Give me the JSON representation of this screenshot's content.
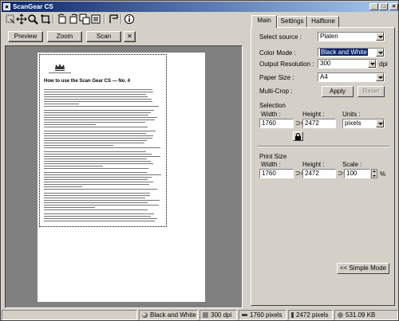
{
  "window": {
    "title": "ScanGear CS",
    "controls": {
      "minimize": "_",
      "maximize": "□",
      "close": "×"
    }
  },
  "toolbar_icons": [
    "marquee-select-icon",
    "move-icon",
    "zoom-icon",
    "crop-icon",
    "rotate-left-icon",
    "rotate-right-icon",
    "copy-icon",
    "auto-crop-icon",
    "mirror-icon",
    "info-icon"
  ],
  "buttons": {
    "preview": "Preview",
    "zoom": "Zoom",
    "scan": "Scan",
    "clear": "✕"
  },
  "preview": {
    "document_heading": "How to use the Scan Gear CS — No. 4"
  },
  "tabs": [
    {
      "label": "Main",
      "active": true
    },
    {
      "label": "Settings",
      "active": false
    },
    {
      "label": "Halftone",
      "active": false
    }
  ],
  "main": {
    "select_source_label": "Select source :",
    "select_source_value": "Platen",
    "color_mode_label": "Color Mode :",
    "color_mode_value": "Black and White",
    "output_resolution_label": "Output Resolution :",
    "output_resolution_value": "300",
    "dpi_unit": "dpi",
    "paper_size_label": "Paper Size :",
    "paper_size_value": "A4",
    "multi_crop_label": "Multi-Crop :",
    "apply_label": "Apply",
    "reset_label": "Reset",
    "selection_label": "Selection",
    "width_label": "Width :",
    "height_label": "Height :",
    "units_label": "Units :",
    "selection_width": "1760",
    "selection_height": "2472",
    "units_value": "pixels",
    "print_size_label": "Print Size",
    "print_width_label": "Width :",
    "print_height_label": "Height :",
    "scale_label": "Scale :",
    "print_width": "1760",
    "print_height": "2472",
    "scale_value": "100",
    "percent": "%",
    "simple_mode_label": "<< Simple Mode"
  },
  "status": {
    "color_mode": "Black and White",
    "resolution": "300 dpi",
    "width": "1760 pixels",
    "height": "2472 pixels",
    "size": "531.09 KB"
  },
  "colors": {
    "title_bar_start": "#0a246a",
    "title_bar_end": "#a6caf0",
    "face": "#d4d0c8",
    "preview_bg": "#808080",
    "highlight": "#0a246a"
  }
}
